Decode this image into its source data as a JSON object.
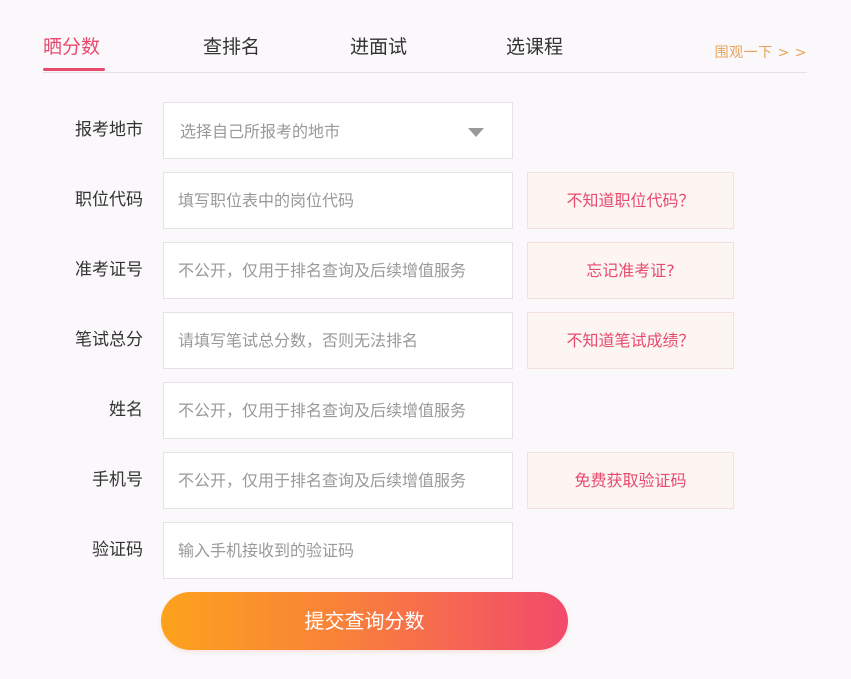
{
  "tabs": [
    {
      "label": "晒分数",
      "active": true
    },
    {
      "label": "查排名",
      "active": false
    },
    {
      "label": "进面试",
      "active": false
    },
    {
      "label": "选课程",
      "active": false
    }
  ],
  "more_link": "围观一下 > >",
  "form": {
    "region": {
      "label": "报考地市",
      "placeholder": "选择自己所报考的地市",
      "icon": "chevron-down-icon"
    },
    "position_code": {
      "label": "职位代码",
      "placeholder": "填写职位表中的岗位代码",
      "aux_button": "不知道职位代码？"
    },
    "admission_ticket": {
      "label": "准考证号",
      "placeholder": "不公开，仅用于排名查询及后续增值服务",
      "aux_button": "忘记准考证?"
    },
    "written_score": {
      "label": "笔试总分",
      "placeholder": "请填写笔试总分数，否则无法排名",
      "aux_button": "不知道笔试成绩？"
    },
    "name": {
      "label": "姓名",
      "placeholder": "不公开，仅用于排名查询及后续增值服务"
    },
    "phone": {
      "label": "手机号",
      "placeholder": "不公开，仅用于排名查询及后续增值服务",
      "aux_button": "免费获取验证码"
    },
    "verify_code": {
      "label": "验证码",
      "placeholder": "输入手机接收到的验证码"
    },
    "submit_label": "提交查询分数"
  },
  "colors": {
    "accent": "#e84a6e",
    "link": "#e8a35a",
    "aux_bg": "#fdf5f2",
    "gradient_start": "#fca21c",
    "gradient_end": "#f24a6c"
  }
}
